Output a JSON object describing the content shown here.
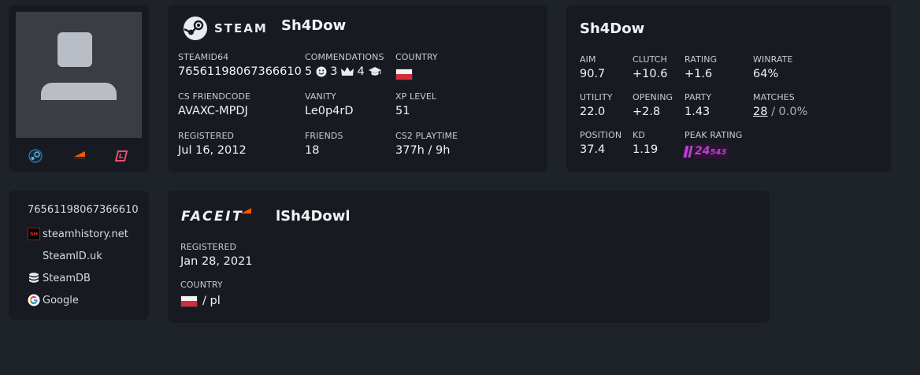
{
  "avatar": {
    "links": [
      {
        "icon": "steam-icon"
      },
      {
        "icon": "faceit-icon"
      },
      {
        "icon": "leetify-icon"
      }
    ]
  },
  "steam": {
    "brand": "STEAM",
    "name": "Sh4Dow",
    "fields": {
      "steamid64": {
        "label": "STEAMID64",
        "value": "76561198067366610"
      },
      "commendations": {
        "label": "COMMENDATIONS",
        "friendly": "5",
        "leader": "3",
        "teacher": "4"
      },
      "country": {
        "label": "COUNTRY",
        "flag": "PL"
      },
      "friendcode": {
        "label": "CS FRIENDCODE",
        "value": "AVAXC-MPDJ"
      },
      "vanity": {
        "label": "VANITY",
        "value": "Le0p4rD"
      },
      "xp": {
        "label": "XP LEVEL",
        "value": "51"
      },
      "registered": {
        "label": "REGISTERED",
        "value": "Jul 16, 2012"
      },
      "friends": {
        "label": "FRIENDS",
        "value": "18"
      },
      "playtime": {
        "label": "CS2 PLAYTIME",
        "value": "377h / 9h"
      }
    }
  },
  "stats": {
    "name": "Sh4Dow",
    "aim": {
      "label": "AIM",
      "value": "90.7"
    },
    "clutch": {
      "label": "CLUTCH",
      "value": "+10.6"
    },
    "rating": {
      "label": "RATING",
      "value": "+1.6"
    },
    "winrate": {
      "label": "WINRATE",
      "value": "64%"
    },
    "utility": {
      "label": "UTILITY",
      "value": "22.0"
    },
    "opening": {
      "label": "OPENING",
      "value": "+2.8"
    },
    "party": {
      "label": "PARTY",
      "value": "1.43"
    },
    "matches": {
      "label": "MATCHES",
      "value": "28",
      "extra": "/ 0.0%"
    },
    "position": {
      "label": "POSITION",
      "value": "37.4"
    },
    "kd": {
      "label": "KD",
      "value": "1.19"
    },
    "peak": {
      "label": "PEAK RATING",
      "big": "24",
      "small": "543",
      "color": "#c13bd6"
    }
  },
  "links": {
    "steamid": "76561198067366610",
    "items": [
      {
        "label": "steamhistory.net",
        "icon": "steamhistory-icon",
        "badge": "SH"
      },
      {
        "label": "SteamID.uk",
        "icon": ""
      },
      {
        "label": "SteamDB",
        "icon": "steamdb-icon"
      },
      {
        "label": "Google",
        "icon": "google-icon"
      }
    ]
  },
  "faceit": {
    "brand": "FACEIT",
    "name": "lSh4Dowl",
    "registered": {
      "label": "REGISTERED",
      "value": "Jan 28, 2021"
    },
    "country": {
      "label": "COUNTRY",
      "flag": "PL",
      "code": "/ pl"
    }
  },
  "colors": {
    "background": "#1e2229",
    "card": "#171b21",
    "faceit_orange": "#ff5500",
    "peak_purple": "#c13bd6"
  }
}
